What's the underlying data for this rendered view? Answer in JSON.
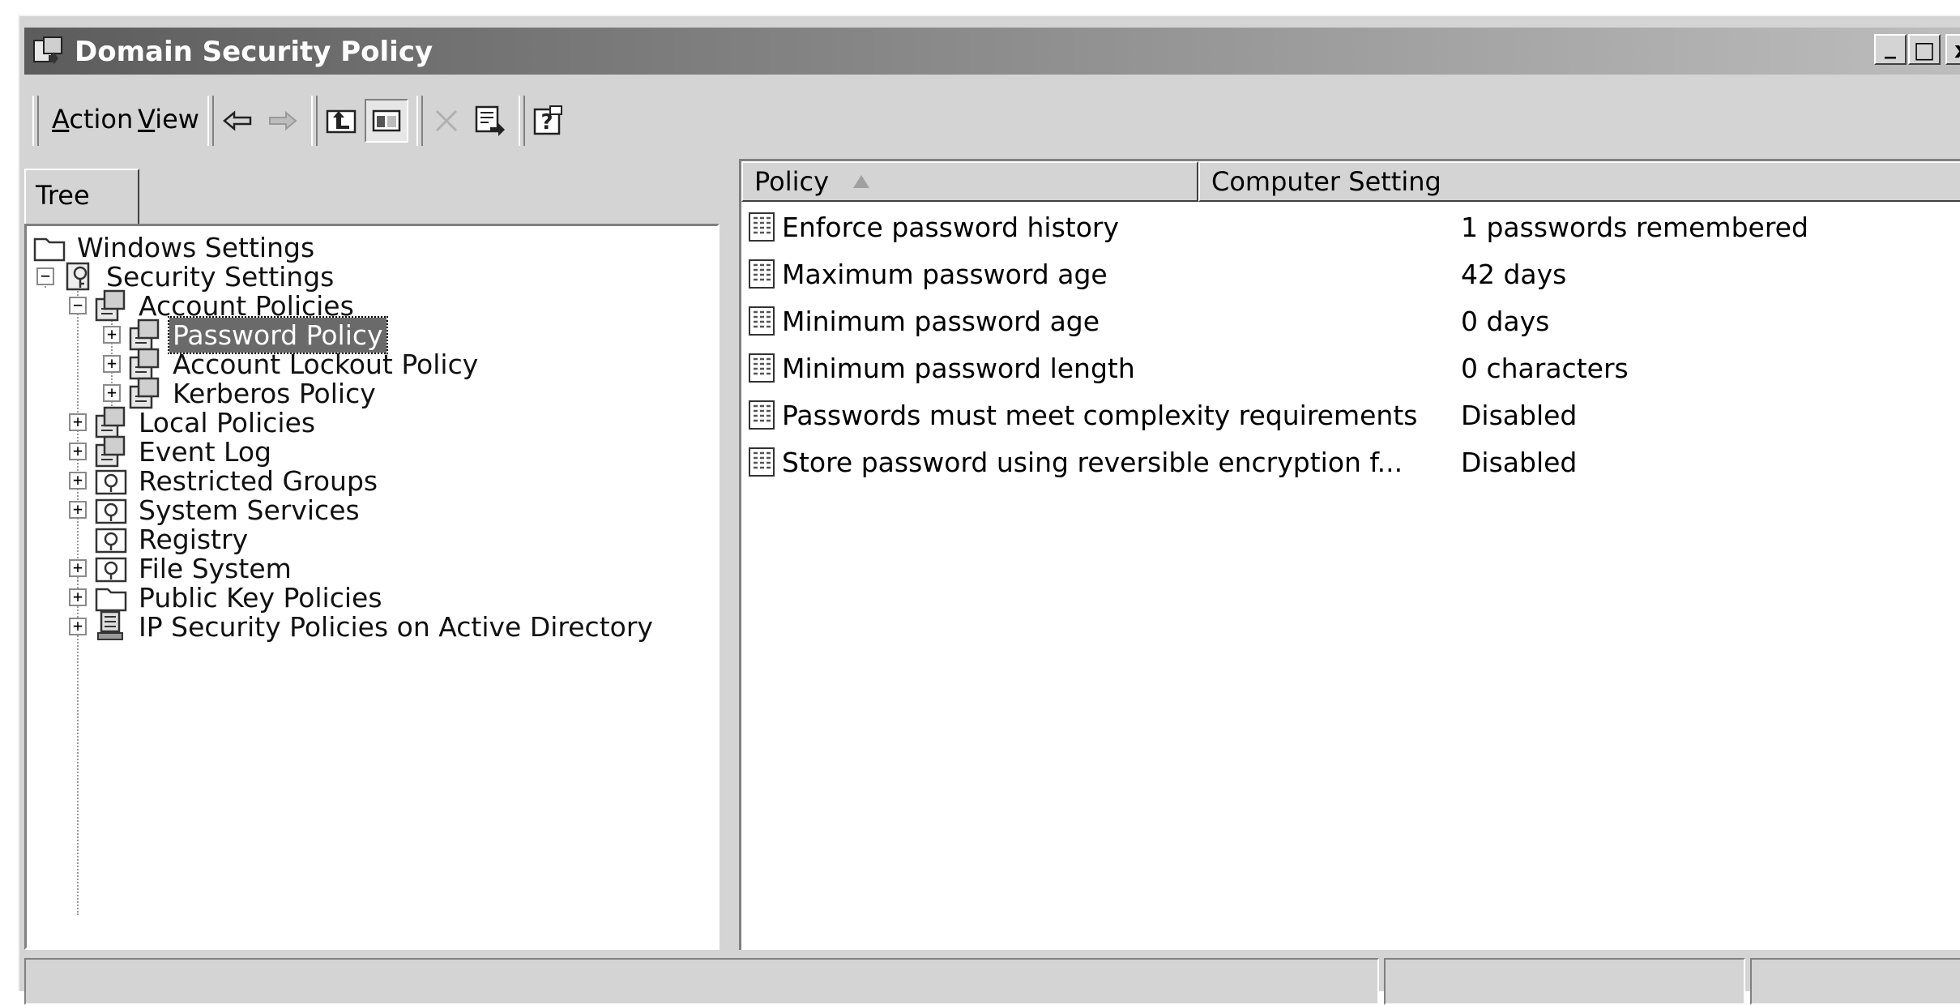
{
  "window": {
    "title": "Domain Security Policy",
    "minimize": "_",
    "maximize": "□",
    "close": "x"
  },
  "menu": {
    "action": "Action",
    "action_u": "A",
    "action_rest": "ction",
    "view_u": "V",
    "view_rest": "iew"
  },
  "toolbar": {
    "icons": [
      "back-arrow-icon",
      "forward-arrow-icon",
      "up-folder-icon",
      "show-hide-tree-icon",
      "delete-icon",
      "export-list-icon",
      "help-icon"
    ]
  },
  "tree": {
    "tab_label": "Tree",
    "items": [
      {
        "label": "Windows Settings",
        "icon": "folder-icon"
      },
      {
        "label": "Security Settings",
        "icon": "security-settings-icon"
      },
      {
        "label": "Account Policies",
        "icon": "policy-folder-icon"
      },
      {
        "label": "Password Policy",
        "icon": "policy-folder-icon",
        "selected": true
      },
      {
        "label": "Account Lockout Policy",
        "icon": "policy-folder-icon"
      },
      {
        "label": "Kerberos Policy",
        "icon": "policy-folder-icon"
      },
      {
        "label": "Local Policies",
        "icon": "policy-folder-icon"
      },
      {
        "label": "Event Log",
        "icon": "policy-folder-icon"
      },
      {
        "label": "Restricted Groups",
        "icon": "settings-folder-icon"
      },
      {
        "label": "System Services",
        "icon": "settings-folder-icon"
      },
      {
        "label": "Registry",
        "icon": "settings-folder-icon"
      },
      {
        "label": "File System",
        "icon": "settings-folder-icon"
      },
      {
        "label": "Public Key Policies",
        "icon": "folder-icon"
      },
      {
        "label": "IP Security Policies on Active Directory",
        "icon": "ip-security-icon"
      }
    ]
  },
  "list": {
    "columns": [
      "Policy",
      "Computer Setting"
    ],
    "rows": [
      {
        "policy": "Enforce password history",
        "setting": "1 passwords remembered"
      },
      {
        "policy": "Maximum password age",
        "setting": "42 days"
      },
      {
        "policy": "Minimum password age",
        "setting": "0 days"
      },
      {
        "policy": "Minimum password length",
        "setting": "0 characters"
      },
      {
        "policy": "Passwords must meet complexity requirements",
        "setting": "Disabled"
      },
      {
        "policy": "Store password using reversible encryption f...",
        "setting": "Disabled"
      }
    ]
  },
  "colors": {
    "title_bar_start": "#5c5c5c",
    "selection": "#6a6a6a",
    "face": "#d4d4d4"
  }
}
